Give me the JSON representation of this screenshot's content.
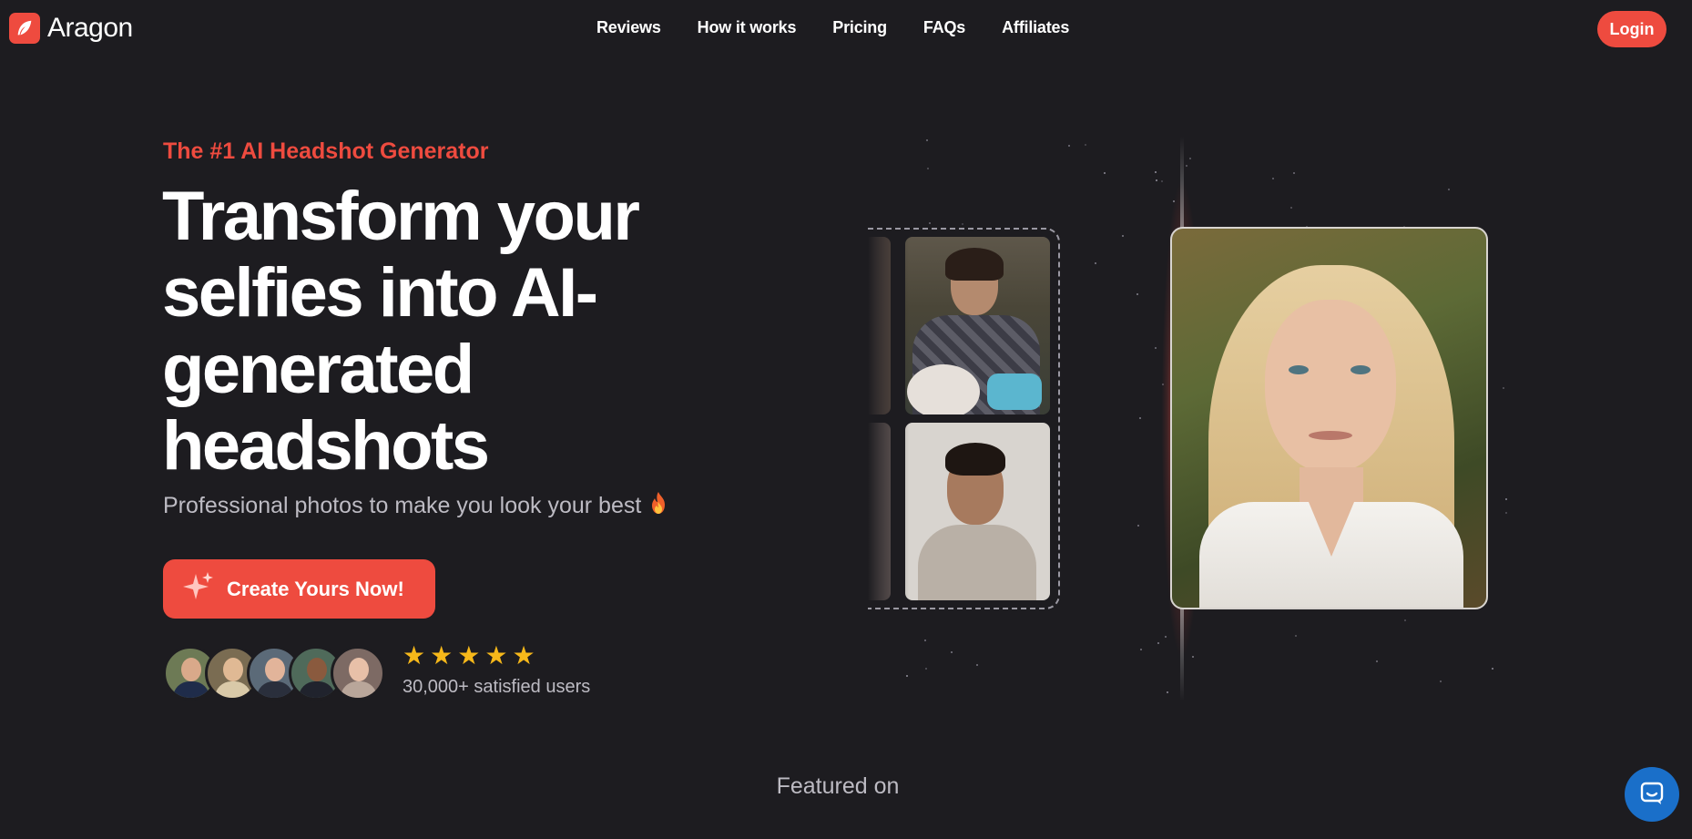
{
  "brand": {
    "name": "Aragon",
    "logo_icon": "feather-icon",
    "accent": "#ee4b3f"
  },
  "nav": {
    "items": [
      {
        "label": "Reviews"
      },
      {
        "label": "How it works"
      },
      {
        "label": "Pricing"
      },
      {
        "label": "FAQs"
      },
      {
        "label": "Affiliates"
      }
    ],
    "login_label": "Login"
  },
  "hero": {
    "eyebrow": "The #1 AI Headshot Generator",
    "headline": "Transform your selfies into AI-generated headshots",
    "subhead": "Professional photos to make you look your best",
    "subhead_icon": "fire-icon",
    "cta_label": "Create Yours Now!",
    "cta_icon": "sparkle-icon",
    "rating_stars": 5,
    "users_text": "30,000+ satisfied users"
  },
  "featured": {
    "label": "Featured on"
  },
  "support": {
    "icon": "chat-icon",
    "color": "#1a6fc9"
  }
}
